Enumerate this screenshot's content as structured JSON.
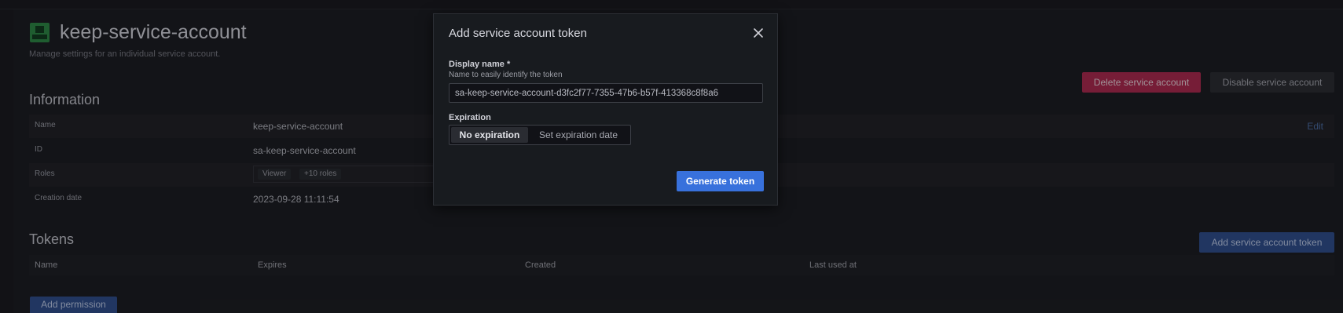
{
  "page": {
    "title": "keep-service-account",
    "subtitle": "Manage settings for an individual service account.",
    "actions": {
      "delete_label": "Delete service account",
      "disable_label": "Disable service account"
    },
    "information": {
      "title": "Information",
      "edit_label": "Edit",
      "rows": [
        {
          "label": "Name",
          "value": "keep-service-account"
        },
        {
          "label": "ID",
          "value": "sa-keep-service-account"
        },
        {
          "label": "Roles",
          "roles": [
            "Viewer",
            "+10 roles"
          ]
        },
        {
          "label": "Creation date",
          "value": "2023-09-28 11:11:54"
        }
      ]
    },
    "tokens": {
      "title": "Tokens",
      "add_label": "Add service account token",
      "columns": [
        "Name",
        "Expires",
        "Created",
        "Last used at"
      ]
    },
    "add_permission_label": "Add permission"
  },
  "modal": {
    "title": "Add service account token",
    "display_name": {
      "label": "Display name *",
      "description": "Name to easily identify the token",
      "value": "sa-keep-service-account-d3fc2f77-7355-47b6-b57f-413368c8f8a6"
    },
    "expiration": {
      "label": "Expiration",
      "options": [
        "No expiration",
        "Set expiration date"
      ],
      "selected": "No expiration"
    },
    "generate_label": "Generate token"
  },
  "colors": {
    "primary": "#3871dc",
    "destructive": "#b1294f",
    "background": "#111217",
    "modal_background": "#181b1f"
  },
  "icons": {
    "close": "close-icon",
    "avatar": "service-account-avatar"
  }
}
